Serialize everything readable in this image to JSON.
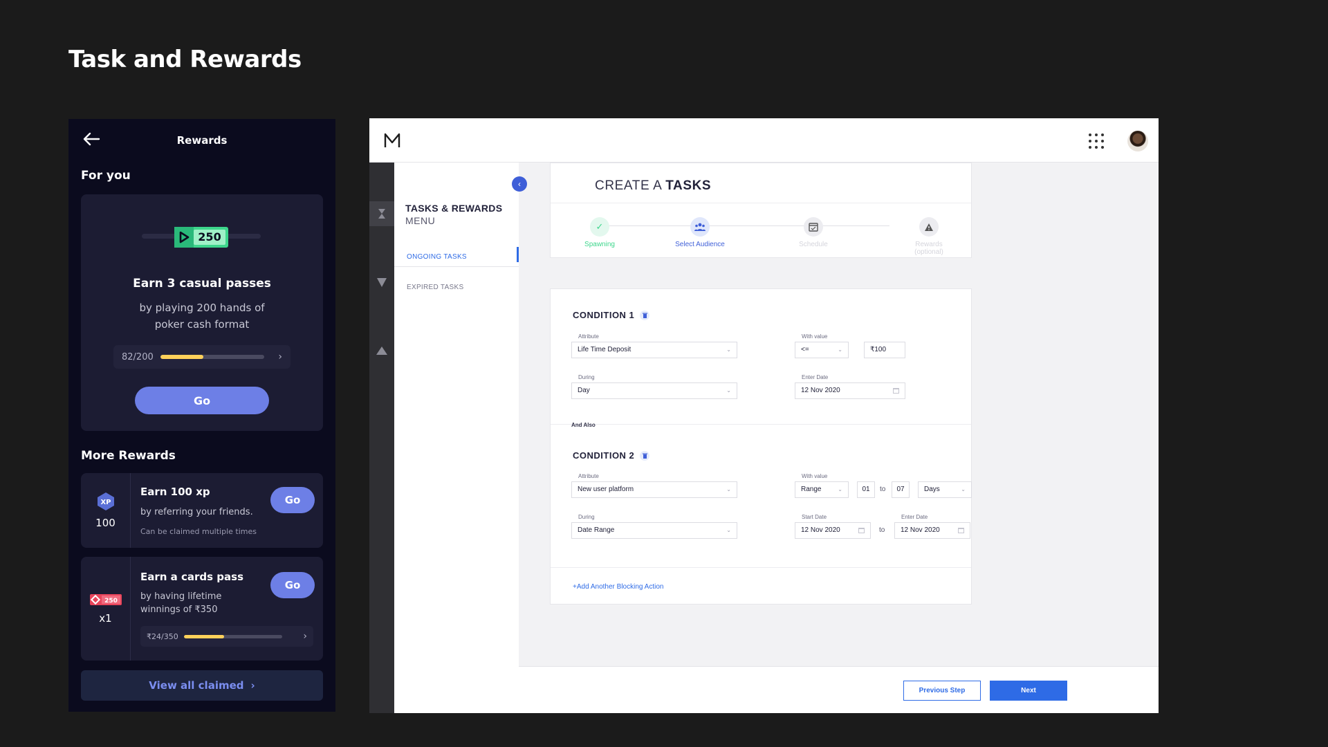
{
  "page": {
    "title": "Task and Rewards"
  },
  "mobile": {
    "title": "Rewards",
    "for_you": "For you",
    "featured": {
      "ticket_value": "250",
      "headline": "Earn 3 casual passes",
      "description": "by playing 200 hands of poker cash format",
      "progress_text": "82/200",
      "progress_fraction": 0.41,
      "go_label": "Go"
    },
    "more_rewards": "More Rewards",
    "rewards": [
      {
        "badge": "XP",
        "qty": "100",
        "title": "Earn 100 xp",
        "description": "by referring your friends.",
        "note": "Can be claimed multiple times",
        "go_label": "Go"
      },
      {
        "badge": "250",
        "qty": "x1",
        "title": "Earn a cards pass",
        "description": "by having lifetime winnings of ₹350",
        "progress_text": "₹24/350",
        "progress_fraction": 0.41,
        "go_label": "Go"
      }
    ],
    "view_all": "View all claimed",
    "colors": {
      "accent": "#6d7fe6",
      "progress": "#ffd15a",
      "ticket": "#3dd68c"
    }
  },
  "desktop": {
    "sidebar": {
      "title": "TASKS & REWARDS",
      "subtitle": "MENU",
      "items": [
        {
          "label": "ONGOING TASKS",
          "active": true
        },
        {
          "label": "EXPIRED TASKS",
          "active": false
        }
      ]
    },
    "create": {
      "title_prefix": "CREATE A",
      "title_bold": "TASKS",
      "steps": [
        {
          "label": "Spawning",
          "state": "done"
        },
        {
          "label": "Select Audience",
          "state": "active"
        },
        {
          "label": "Schedule",
          "state": "pending"
        },
        {
          "label": "Rewards (optional)",
          "state": "pending"
        }
      ]
    },
    "conditions": [
      {
        "title": "CONDITION 1",
        "attribute_label": "Attribute",
        "attribute": "Life Time Deposit",
        "value_label": "With value",
        "operator": "<=",
        "value": "₹100",
        "during_label": "During",
        "during": "Day",
        "date_label": "Enter Date",
        "date": "12 Nov 2020"
      },
      {
        "title": "CONDITION 2",
        "attribute_label": "Attribute",
        "attribute": "New user platform",
        "value_label": "With value",
        "operator": "Range",
        "from": "01",
        "to_word": "to",
        "to": "07",
        "unit": "Days",
        "during_label": "During",
        "during": "Date Range",
        "start_label": "Start Date",
        "start": "12 Nov 2020",
        "end_label": "Enter Date",
        "end": "12 Nov 2020"
      }
    ],
    "and_also": "And Also",
    "add_action": "+Add Another Blocking Action",
    "prev": "Previous Step",
    "next": "Next",
    "colors": {
      "primary": "#2e6be6",
      "success": "#3dd68c"
    }
  }
}
